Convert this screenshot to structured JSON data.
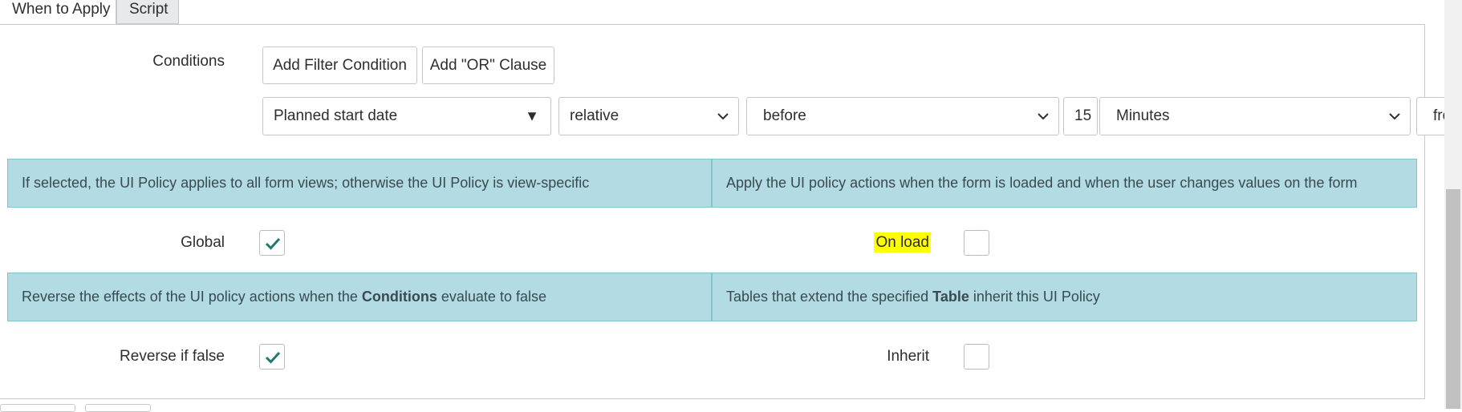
{
  "tabs": [
    {
      "label": "When to Apply",
      "active": true
    },
    {
      "label": "Script",
      "active": false
    }
  ],
  "conditions": {
    "label": "Conditions",
    "add_filter_label": "Add Filter Condition",
    "add_or_label": "Add \"OR\" Clause",
    "field_value": "Planned start date",
    "operator_value": "relative",
    "direction_value": "before",
    "quantity_value": "15",
    "unit_value": "Minutes",
    "trailing_value": "from"
  },
  "info": {
    "global_text": "If selected, the UI Policy applies to all form views; otherwise the UI Policy is view-specific",
    "onload_text": "Apply the UI policy actions when the form is loaded and when the user changes values on the form",
    "reverse_pre": "Reverse the effects of the UI policy actions when the ",
    "reverse_bold": "Conditions",
    "reverse_post": " evaluate to false",
    "inherit_pre": "Tables that extend the specified ",
    "inherit_bold": "Table",
    "inherit_post": " inherit this UI Policy"
  },
  "fields": {
    "global_label": "Global",
    "global_checked": true,
    "onload_label": "On load",
    "onload_checked": false,
    "reverse_label": "Reverse if false",
    "reverse_checked": true,
    "inherit_label": "Inherit",
    "inherit_checked": false
  },
  "colors": {
    "info_bg": "#b3dbe4",
    "check_color": "#1f7a6b",
    "highlight": "#ffff00"
  }
}
